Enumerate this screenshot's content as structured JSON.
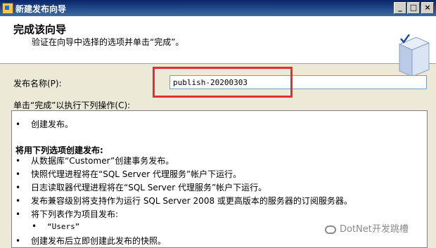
{
  "window": {
    "title": "新建发布向导"
  },
  "header": {
    "title": "完成该向导",
    "subtitle": "验证在向导中选择的选项并单击“完成”。"
  },
  "form": {
    "name_label": "发布名称(P):",
    "name_value": "publish-20200303",
    "actions_label": "单击“完成”以执行下列操作(C):"
  },
  "actions": {
    "l0": "创建发布。",
    "l1": "将用下列选项创建发布:",
    "l2": "从数据库“Customer”创建事务发布。",
    "l3": "快照代理进程将在“SQL Server 代理服务”帐户下运行。",
    "l4": "日志读取器代理进程将在“SQL Server 代理服务”帐户下运行。",
    "l5": "发布兼容级别将支持作为运行 SQL Server 2008 或更高版本的服务器的订阅服务器。",
    "l6": "将下列表作为项目发布:",
    "l7": "“Users”",
    "l8": "创建发布后立即创建此发布的快照。",
    "bullet": "•"
  },
  "watermark": {
    "text": "DotNet开发跳槽"
  },
  "colors": {
    "highlight_box": "#e03030",
    "titlebar": "#0a246a"
  }
}
